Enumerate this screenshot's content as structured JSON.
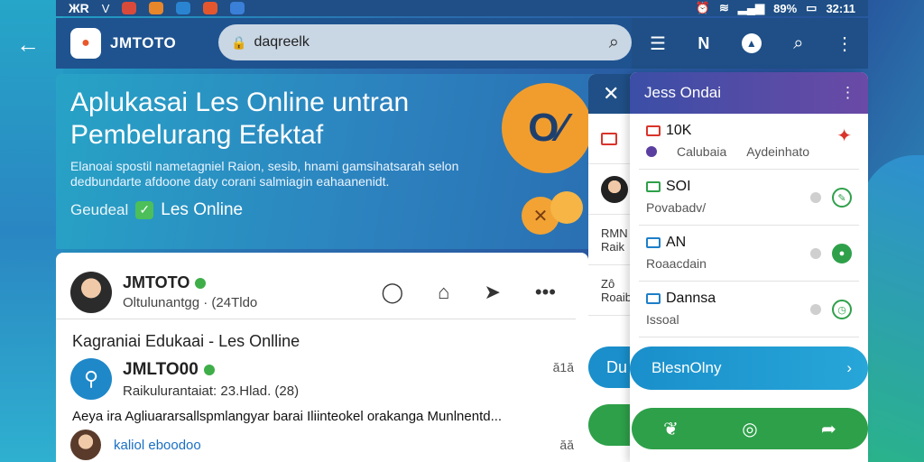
{
  "statusbar": {
    "logo": "ЖR",
    "time": "32:11",
    "battery": "89%"
  },
  "appbar": {
    "brand": "JMTOTO",
    "brand_sub": "",
    "search_value": "daqreelk",
    "search_placeholder": ""
  },
  "hero": {
    "title": "Aplukasai Les Online untran Pembelurang Efektaf",
    "desc": "Elanoai spostil nametagniel Raion, sesib, hnami gamsihatsarah selon dedbundarte afdoone daty corani salmiagin eahaanenidt.",
    "tag_label": "Geudeal",
    "tag_strong": "Les Online",
    "art_text": "O⁄"
  },
  "post1": {
    "name": "JMTOTO",
    "meta": "Oltulunantgg · (24Tldo"
  },
  "feed": {
    "section_title": "Kagraniai Edukaai - Les Onlline",
    "post2": {
      "name": "JMLTO00",
      "meta": "Raikulurantaiat: 23.Hlad. (28)",
      "side": "ă1ă"
    },
    "body": "Aeya ira Agliuararsallspmlangyar barai Iliinteokel orakanga Munlnentd...",
    "post3": {
      "link": "kaliol eboodoo",
      "side": "ăă"
    }
  },
  "midpanel": {
    "items": [
      "",
      "",
      "RMN Raik",
      "Zô Roaib"
    ],
    "pill_blue": "Du",
    "pill_green": ""
  },
  "rbar": {
    "m_label": "N"
  },
  "rpanel": {
    "title": "Jess Ondai",
    "items": [
      {
        "title": "10K",
        "sub1": "Calubaia",
        "sub2": "Aydeinhato",
        "color": "#d9342b"
      },
      {
        "title": "SOI",
        "sub1": "Povabadv/",
        "sub2": "",
        "color": "#2ea04a"
      },
      {
        "title": "AN",
        "sub1": "Roaacdain",
        "sub2": "",
        "color": "#1e7fc8"
      },
      {
        "title": "Dannsa",
        "sub1": "Issoal",
        "sub2": "",
        "color": "#1e7fc8"
      }
    ],
    "cta": "BlesnOlny"
  },
  "colors": {
    "primary": "#1f4f86",
    "accent_green": "#2ea049",
    "accent_blue": "#1a8fcb",
    "orange": "#f19d2d"
  }
}
